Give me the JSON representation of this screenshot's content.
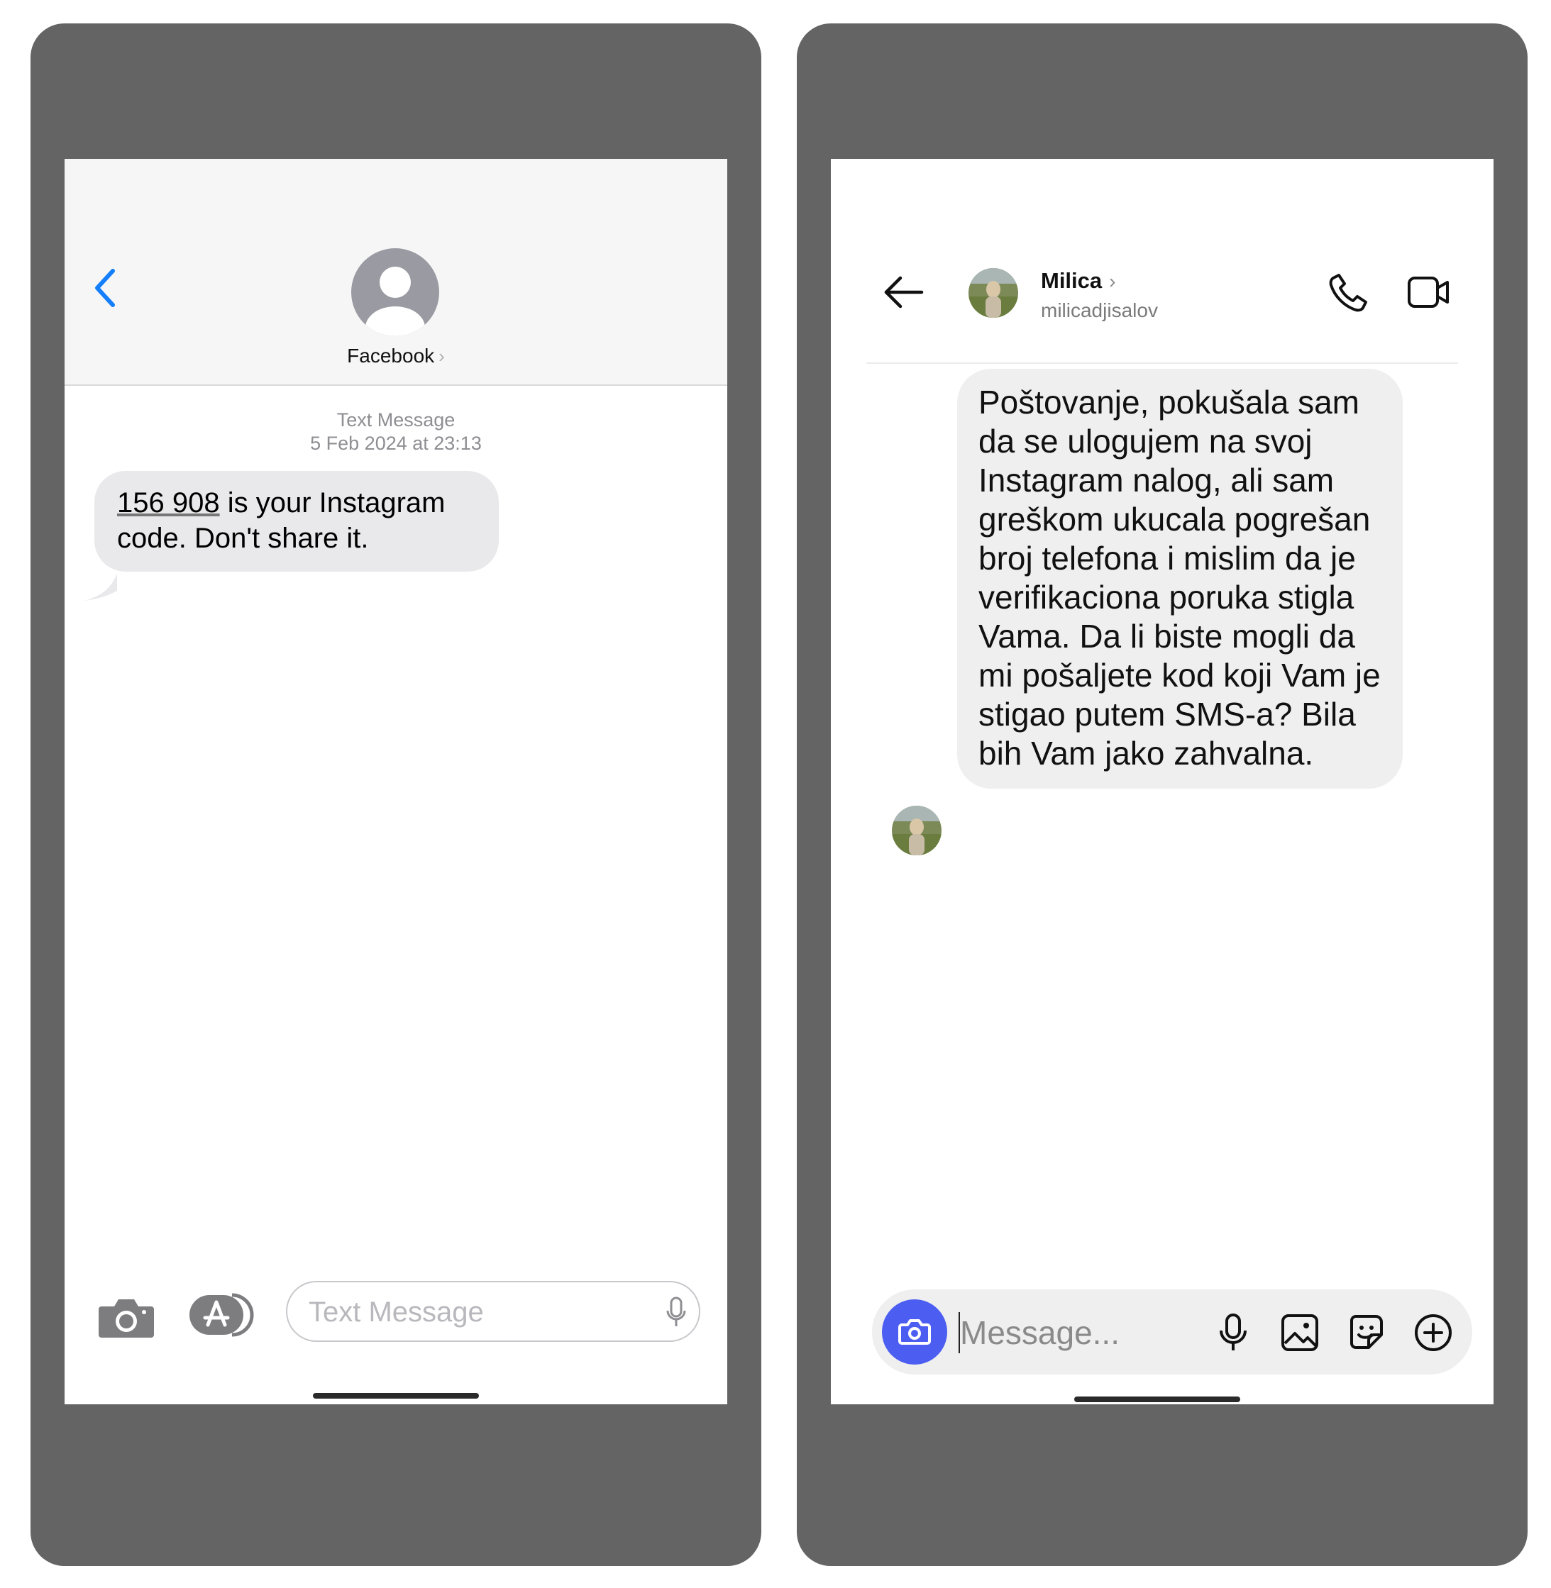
{
  "sms": {
    "contact_name": "Facebook",
    "contact_chevron": "›",
    "meta_label": "Text Message",
    "meta_date": "5 Feb 2024 at 23:13",
    "message_code": "156 908",
    "message_rest": " is your Instagram code. Don't share it.",
    "input_placeholder": "Text Message",
    "icons": [
      "back-chevron-icon",
      "person-icon",
      "camera-icon",
      "app-store-icon",
      "microphone-icon"
    ],
    "accent_color": "#147efb"
  },
  "instagram": {
    "contact_name": "Milica",
    "contact_chevron": "›",
    "contact_handle": "milicadjisalov",
    "message": "Poštovanje, pokušala sam da se ulogujem na svoj Instagram nalog, ali sam greškom ukucala pogrešan broj telefona i mislim da je verifikaciona poruka stigla Vama. Da li biste mogli da mi pošaljete kod koji Vam je stigao putem SMS-a? Bila bih Vam jako zahvalna.",
    "input_placeholder": "Message...",
    "icons": [
      "back-arrow-icon",
      "phone-icon",
      "video-icon",
      "camera-icon",
      "microphone-icon",
      "gallery-icon",
      "sticker-icon",
      "plus-icon"
    ],
    "accent_color": "#4c5ef2"
  }
}
